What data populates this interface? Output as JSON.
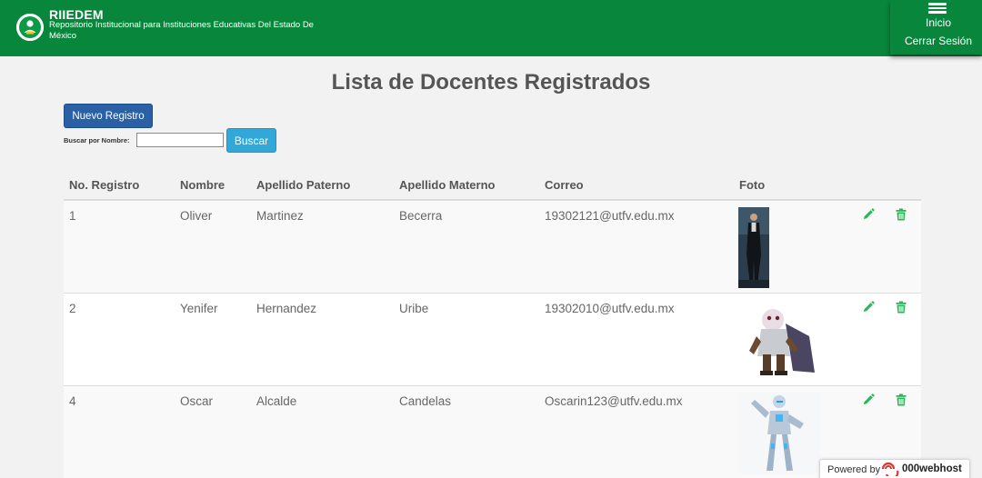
{
  "header": {
    "brand_title": "RIIEDEM",
    "brand_subtitle": "Repositorio Institucional para Instituciones Educativas Del Estado De México",
    "menu": {
      "inicio": "Inicio",
      "cerrar_sesion": "Cerrar Sesión"
    }
  },
  "page": {
    "title": "Lista de Docentes Registrados"
  },
  "toolbar": {
    "nuevo_label": "Nuevo Registro",
    "search_label": "Buscar por Nombre:",
    "search_value": "",
    "search_button": "Buscar"
  },
  "table": {
    "columns": [
      "No. Registro",
      "Nombre",
      "Apellido Paterno",
      "Apellido Materno",
      "Correo",
      "Foto"
    ],
    "rows": [
      {
        "id": "1",
        "nombre": "Oliver",
        "paterno": "Martinez",
        "materno": "Becerra",
        "correo": "19302121@utfv.edu.mx"
      },
      {
        "id": "2",
        "nombre": "Yenifer",
        "paterno": "Hernandez",
        "materno": "Uribe",
        "correo": "19302010@utfv.edu.mx"
      },
      {
        "id": "4",
        "nombre": "Oscar",
        "paterno": "Alcalde",
        "materno": "Candelas",
        "correo": "Oscarin123@utfv.edu.mx"
      }
    ]
  },
  "footer_badge": {
    "powered_by": "Powered by",
    "brand": "000webhost"
  },
  "colors": {
    "header_green": "#08873c",
    "primary_blue": "#2a60a6",
    "info_blue": "#32a8da",
    "action_green": "#2bb55a"
  },
  "icons": {
    "edit": "pencil-icon",
    "delete": "trash-icon",
    "menu": "hamburger-icon"
  }
}
